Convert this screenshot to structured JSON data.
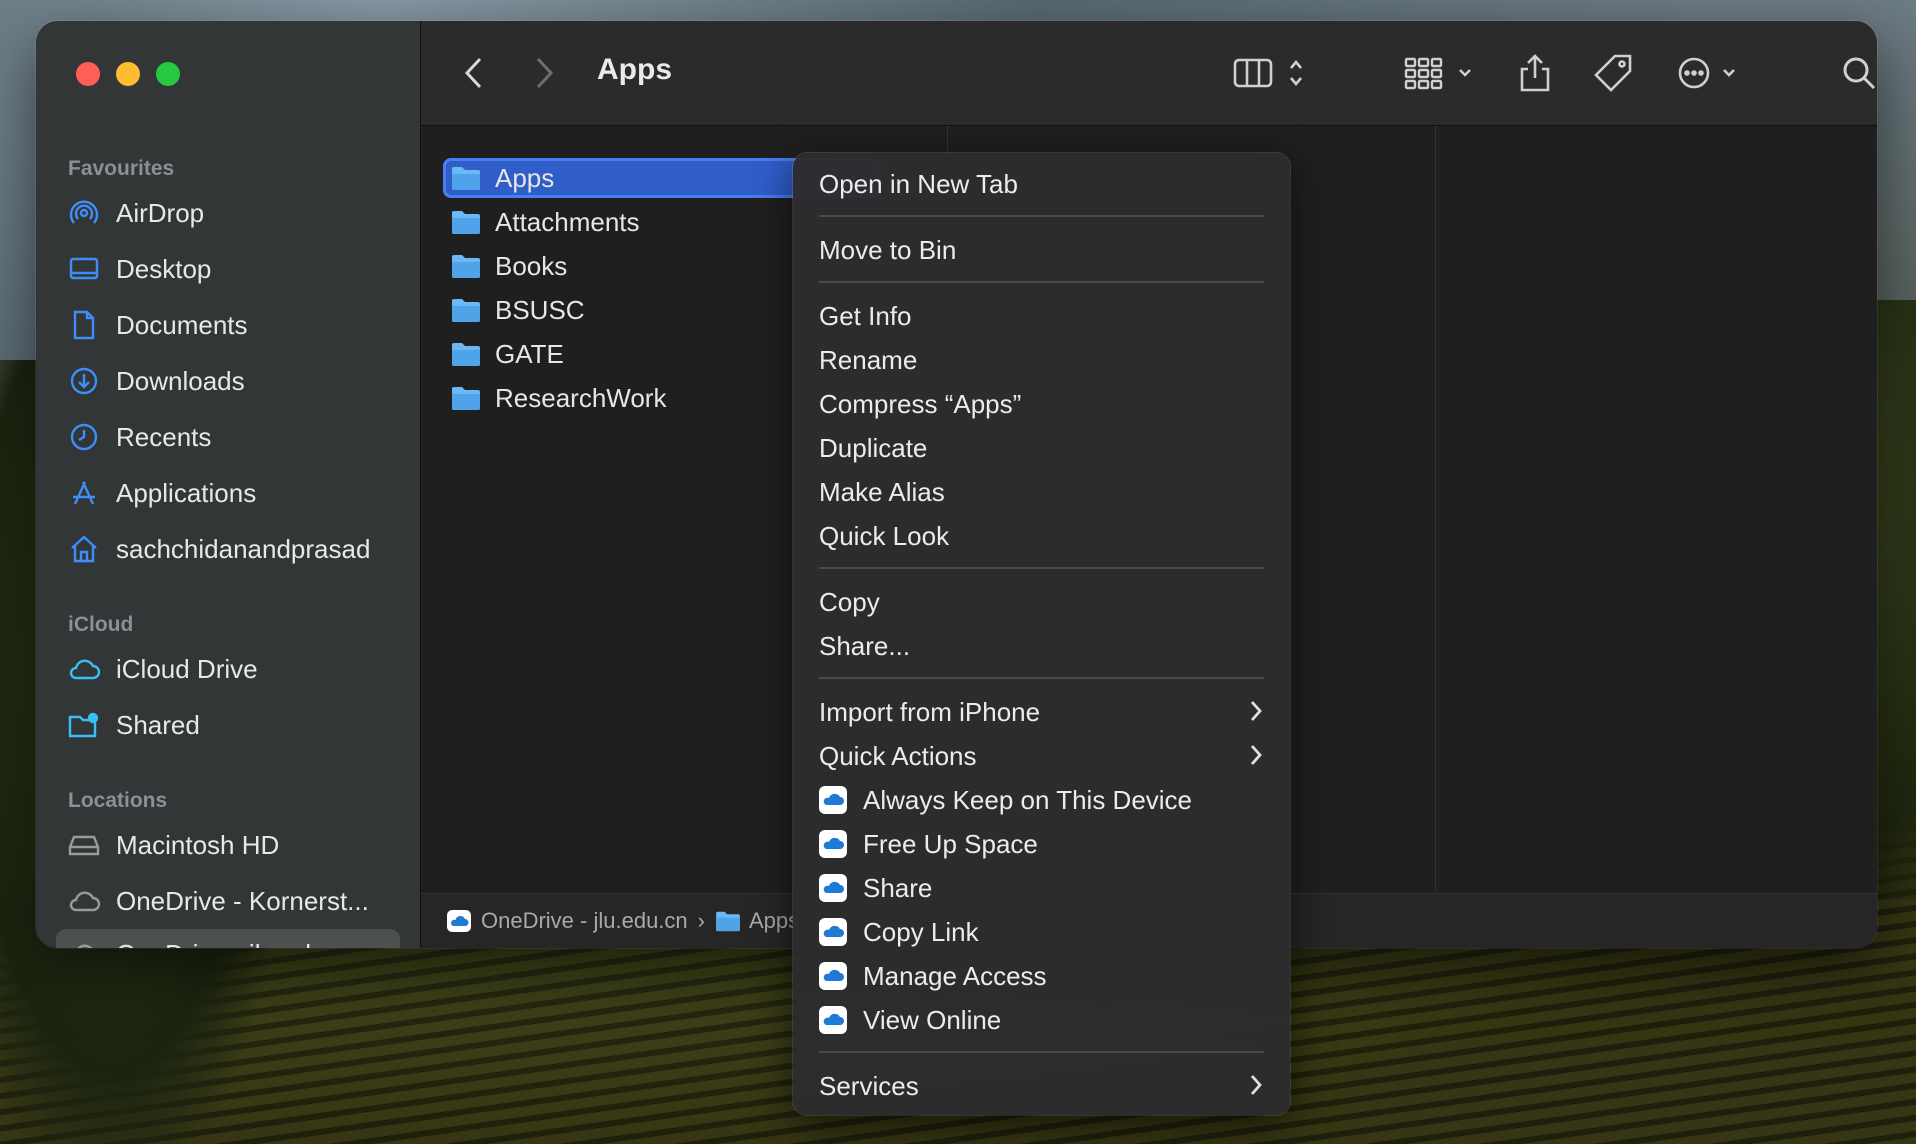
{
  "window": {
    "title": "Apps",
    "colors": {
      "accent": "#2f5ec9",
      "folder": "#4fa3e8",
      "sidebar_icon": "#3d8ef7"
    }
  },
  "sidebar": {
    "favourites_label": "Favourites",
    "favourites": [
      {
        "label": "AirDrop",
        "icon": "airdrop-icon"
      },
      {
        "label": "Desktop",
        "icon": "desktop-icon"
      },
      {
        "label": "Documents",
        "icon": "document-icon"
      },
      {
        "label": "Downloads",
        "icon": "download-icon"
      },
      {
        "label": "Recents",
        "icon": "clock-icon"
      },
      {
        "label": "Applications",
        "icon": "applications-icon"
      },
      {
        "label": "sachchidanandprasad",
        "icon": "home-icon"
      }
    ],
    "icloud_label": "iCloud",
    "icloud": [
      {
        "label": "iCloud Drive",
        "icon": "cloud-icon"
      },
      {
        "label": "Shared",
        "icon": "shared-folder-icon"
      }
    ],
    "locations_label": "Locations",
    "locations": [
      {
        "label": "Macintosh HD",
        "icon": "disk-icon"
      },
      {
        "label": "OneDrive - Kornerst...",
        "icon": "cloud-icon"
      },
      {
        "label": "OneDrive - jlu.edu.cn",
        "icon": "cloud-icon",
        "selected": true
      }
    ]
  },
  "files": [
    {
      "name": "Apps",
      "selected": true
    },
    {
      "name": "Attachments"
    },
    {
      "name": "Books"
    },
    {
      "name": "BSUSC"
    },
    {
      "name": "GATE"
    },
    {
      "name": "ResearchWork"
    }
  ],
  "pathbar": {
    "root": "OneDrive - jlu.edu.cn",
    "separator": "›",
    "current": "Apps"
  },
  "context_menu": {
    "open_new_tab": "Open in New Tab",
    "move_to_bin": "Move to Bin",
    "get_info": "Get Info",
    "rename": "Rename",
    "compress": "Compress “Apps”",
    "duplicate": "Duplicate",
    "make_alias": "Make Alias",
    "quick_look": "Quick Look",
    "copy": "Copy",
    "share_dots": "Share...",
    "import_iphone": "Import from iPhone",
    "quick_actions": "Quick Actions",
    "always_keep": "Always Keep on This Device",
    "free_up": "Free Up Space",
    "share": "Share",
    "copy_link": "Copy Link",
    "manage_access": "Manage Access",
    "view_online": "View Online",
    "services": "Services"
  }
}
